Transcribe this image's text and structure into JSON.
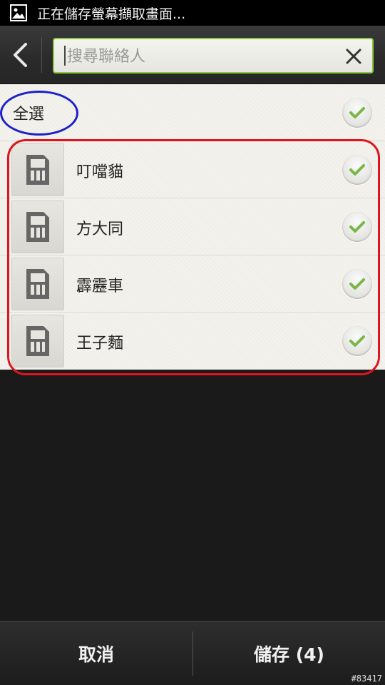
{
  "status_bar": {
    "notification": "正在儲存螢幕擷取畫面..."
  },
  "header": {
    "search_placeholder": "搜尋聯絡人"
  },
  "list": {
    "select_all_label": "全選",
    "select_all_checked": true,
    "contacts": [
      {
        "name": "叮噹貓",
        "checked": true,
        "icon": "sim-card-icon"
      },
      {
        "name": "方大同",
        "checked": true,
        "icon": "sim-card-icon"
      },
      {
        "name": "霹靂車",
        "checked": true,
        "icon": "sim-card-icon"
      },
      {
        "name": "王子麵",
        "checked": true,
        "icon": "sim-card-icon"
      }
    ]
  },
  "footer": {
    "cancel_label": "取消",
    "save_label": "儲存 (4)"
  },
  "watermark": "#83417",
  "colors": {
    "accent_green": "#8cc63f",
    "check_green": "#7ab648",
    "annotation_blue": "#1c21c8",
    "annotation_red": "#e0141e"
  }
}
